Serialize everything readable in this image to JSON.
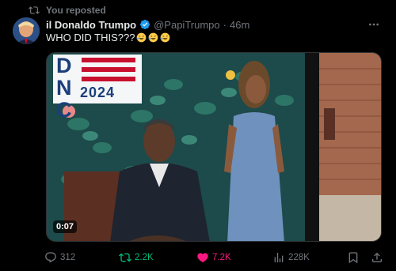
{
  "repost_banner": {
    "text": "You reposted"
  },
  "post": {
    "display_name": "il Donaldo Trumpo",
    "handle": "@PapiTrumpo",
    "separator": "·",
    "time": "46m",
    "text": "WHO DID THIS???",
    "emojis": [
      "rolling-on-floor-laughing",
      "rolling-on-floor-laughing",
      "rolling-on-floor-laughing"
    ]
  },
  "media": {
    "sign_letters": [
      "D",
      "N",
      "C"
    ],
    "sign_year": "2024",
    "video_timestamp": "0:07"
  },
  "actions": {
    "replies": "312",
    "reposts": "2.2K",
    "likes": "7.2K",
    "views": "228K"
  },
  "colors": {
    "background": "#000000",
    "text": "#e7e9ea",
    "muted": "#71767b",
    "verified": "#1d9bf0",
    "repost_active": "#00ba7c",
    "like_active": "#f91880"
  }
}
